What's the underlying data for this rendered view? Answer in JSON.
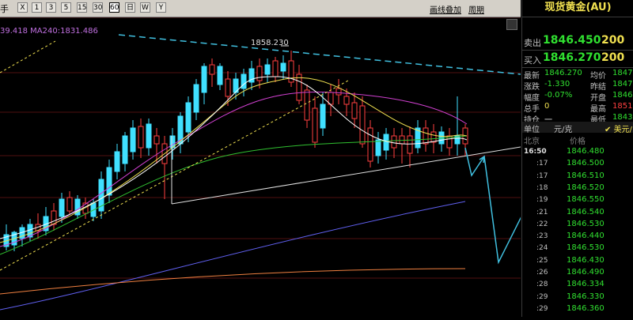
{
  "toolbar": {
    "first_label": "手",
    "buttons": [
      "X",
      "1",
      "3",
      "5",
      "15",
      "30",
      "60",
      "日",
      "W",
      "Y"
    ],
    "selected_index": 6,
    "links": [
      "画线叠加",
      "周期"
    ]
  },
  "chart": {
    "ma_legend": "39.418  MA240:1831.486",
    "high_label": "1858.230"
  },
  "quote": {
    "title": "现货黄金(AU)",
    "sell_label": "卖出",
    "sell_price": "1846.450",
    "sell_size": "200",
    "buy_label": "买入",
    "buy_price": "1846.270",
    "buy_size": "200",
    "stats": [
      {
        "label": "最新",
        "value": "1846.270",
        "label2": "均价",
        "value2": "1847"
      },
      {
        "label": "涨跌",
        "value": "-1.330",
        "label2": "昨结",
        "value2": "1847"
      },
      {
        "label": "幅度",
        "value": "-0.07%",
        "label2": "开盘",
        "value2": "1846"
      },
      {
        "label": "总手",
        "value": "0",
        "label2": "最高",
        "value2": "1851"
      },
      {
        "label": "持仓",
        "value": "一",
        "label2": "最低",
        "value2": "1843"
      }
    ],
    "col_unit": "单位",
    "col_unit_val": "元/克",
    "col_cur": "美元/",
    "col_loc": "北京",
    "col_price": "价格",
    "ticks": [
      {
        "time": "16:50",
        "price": "1846.480"
      },
      {
        "time": ":17",
        "price": "1846.500"
      },
      {
        "time": ":17",
        "price": "1846.510"
      },
      {
        "time": ":18",
        "price": "1846.520"
      },
      {
        "time": ":19",
        "price": "1846.550"
      },
      {
        "time": ":21",
        "price": "1846.540"
      },
      {
        "time": ":22",
        "price": "1846.530"
      },
      {
        "time": ":23",
        "price": "1846.440"
      },
      {
        "time": ":24",
        "price": "1846.530"
      },
      {
        "time": ":25",
        "price": "1846.430"
      },
      {
        "time": ":26",
        "price": "1846.490"
      },
      {
        "time": ":28",
        "price": "1846.334"
      },
      {
        "time": ":29",
        "price": "1846.330"
      },
      {
        "time": ":29",
        "price": "1846.360"
      }
    ]
  },
  "colors": {
    "up": "#ff4040",
    "down": "#40e0ff",
    "ma5": "#ffffff",
    "ma10": "#f0e050",
    "ma20": "#d040d0",
    "ma60": "#30c030",
    "ma120": "#6060f0",
    "ma240": "#f08040"
  }
}
